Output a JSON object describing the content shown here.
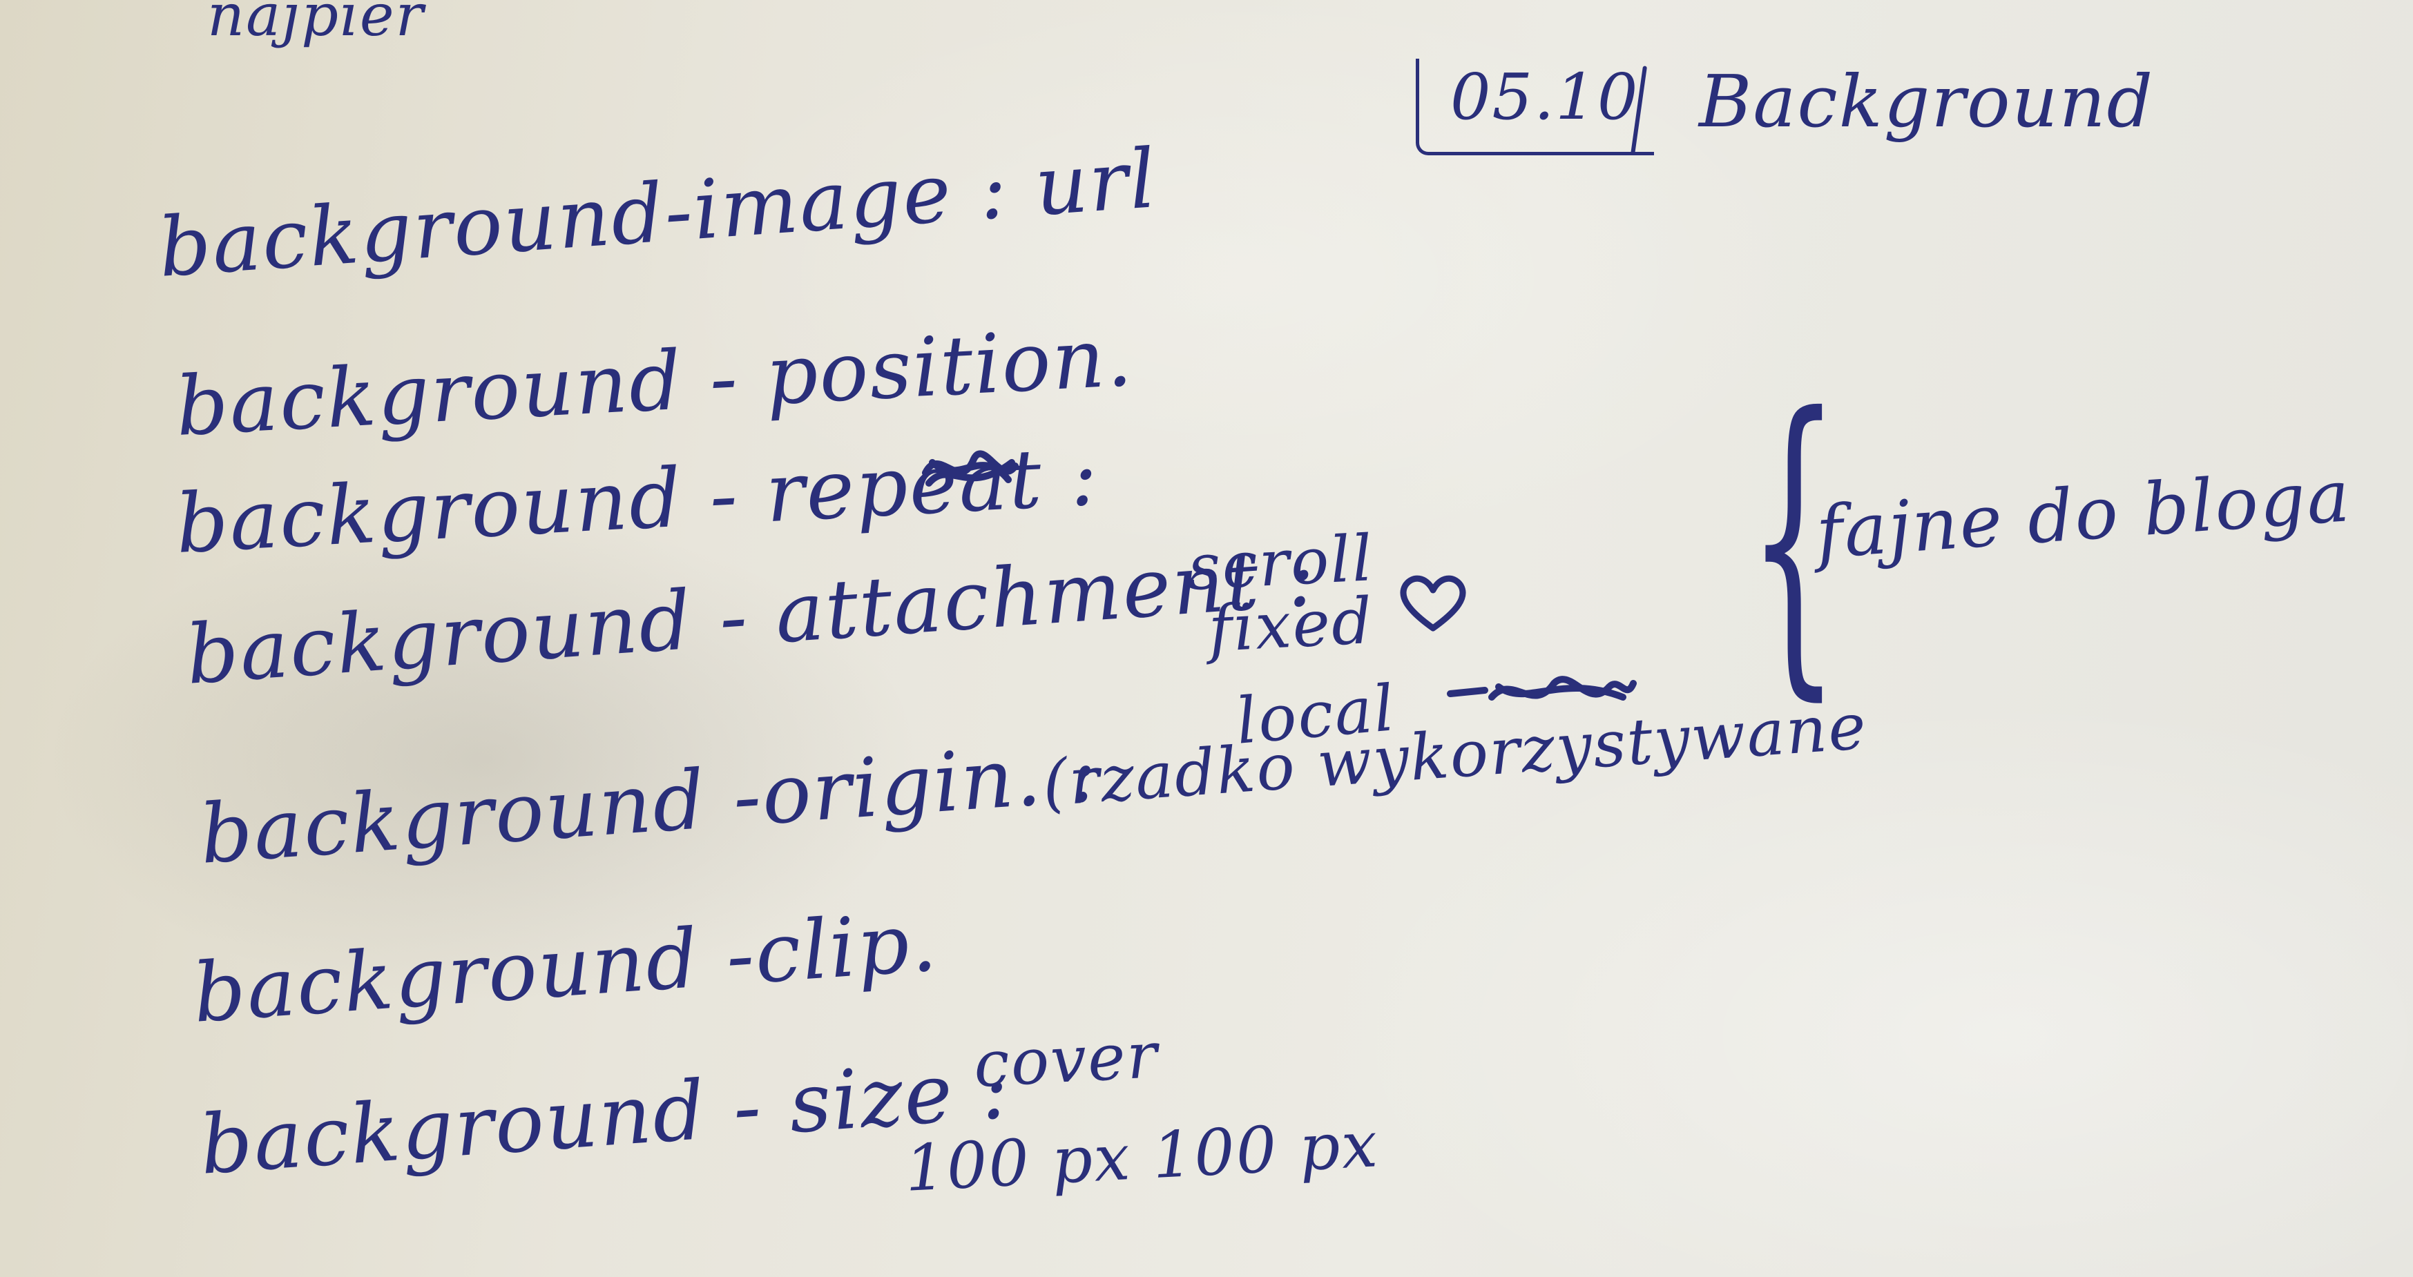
{
  "top_partial": {
    "fragment": "najpier"
  },
  "header": {
    "date": "05.10",
    "title": "Background"
  },
  "lines": {
    "image": "background-image : url",
    "position": "background - position.",
    "repeat": "background - repeat :",
    "attachment": "background - attachment :",
    "origin": "background -origin. :",
    "clip": "background -clip.",
    "size": "background - size :"
  },
  "attachment_values": {
    "scroll": "scroll",
    "fixed": "fixed",
    "local": "local"
  },
  "origin_note": "(rzadko wykorzystywane",
  "size_values": {
    "cover": "cover",
    "pixels": "100 px  100 px"
  },
  "side_note": "fajne do bloga",
  "ink_color": "#2a2f7a"
}
